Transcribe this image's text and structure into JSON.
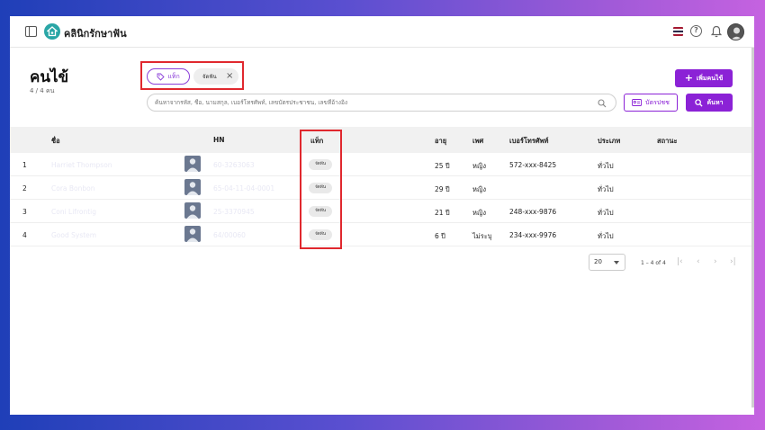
{
  "app": {
    "brand_name": "คลินิกรักษาฟัน"
  },
  "header": {
    "flag_colors": [
      "#a51931",
      "#f4f5f8",
      "#2d2a4a",
      "#f4f5f8",
      "#a51931"
    ]
  },
  "page": {
    "title": "คนไข้",
    "count": "4 / 4 คน"
  },
  "filters": {
    "tag_button_label": "แท็ก",
    "active_chip": "จัดฟัน"
  },
  "actions": {
    "add_patient": "เพิ่มคนไข้",
    "id_card": "บัตรปชช",
    "search": "ค้นหา"
  },
  "search": {
    "placeholder": "ค้นหาจากรหัส, ชื่อ, นามสกุล, เบอร์โทรศัพท์, เลขบัตรประชาชน, เลขที่อ้างอิง"
  },
  "table": {
    "columns": {
      "name": "ชื่อ",
      "hn": "HN",
      "tag": "แท็ก",
      "age": "อายุ",
      "gender": "เพศ",
      "phone": "เบอร์โทรศัพท์",
      "type": "ประเภท",
      "status": "สถานะ"
    },
    "rows": [
      {
        "index": "1",
        "name": "Harriet Thompson",
        "hn": "60-3263063",
        "tag": "จัดฟัน",
        "age": "25 ปี",
        "gender": "หญิง",
        "phone": "572-xxx-8425",
        "type": "ทั่วไป"
      },
      {
        "index": "2",
        "name": "Cora Bonbon",
        "hn": "65-04-11-04-0001",
        "tag": "จัดฟัน",
        "age": "29 ปี",
        "gender": "หญิง",
        "phone": "",
        "type": "ทั่วไป"
      },
      {
        "index": "3",
        "name": "Coni Lifrontig",
        "hn": "25-3370945",
        "tag": "จัดฟัน",
        "age": "21 ปี",
        "gender": "หญิง",
        "phone": "248-xxx-9876",
        "type": "ทั่วไป"
      },
      {
        "index": "4",
        "name": "Good System",
        "hn": "64/00060",
        "tag": "จัดฟัน",
        "age": "6 ปี",
        "gender": "ไม่ระบุ",
        "phone": "234-xxx-9976",
        "type": "ทั่วไป"
      }
    ]
  },
  "pagination": {
    "page_size": "20",
    "range": "1 – 4 of 4",
    "first": "|‹",
    "prev": "‹",
    "next": "›",
    "last": "›|"
  }
}
